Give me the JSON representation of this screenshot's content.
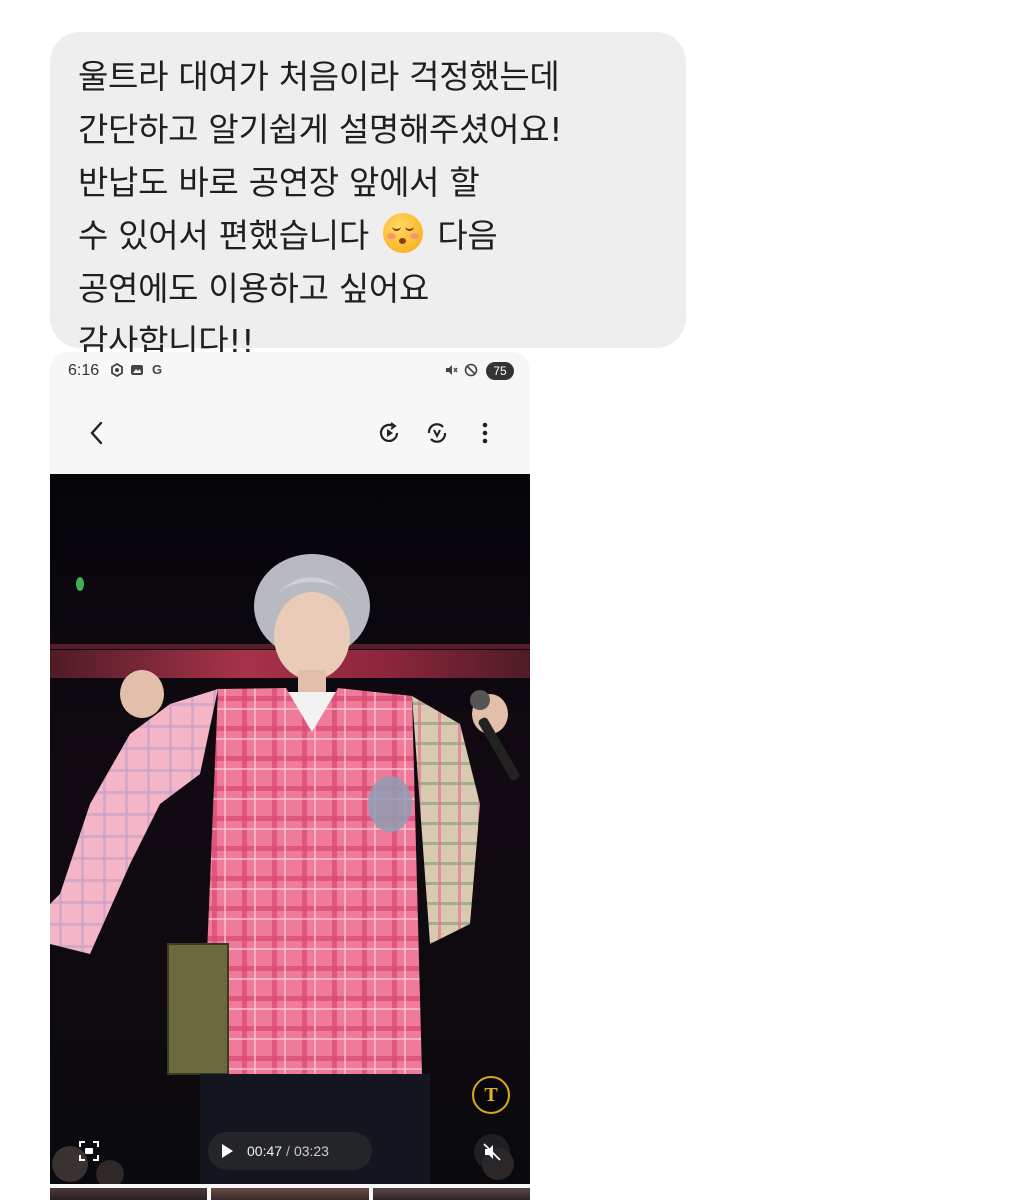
{
  "message": {
    "lines": [
      "울트라 대여가 처음이라 걱정했는데",
      "간단하고 알기쉽게 설명해주셨어요!",
      "반납도 바로 공연장 앞에서 할",
      "수 있어서 편했습니다",
      "다음",
      "공연에도 이용하고 싶어요",
      "감사합니다!!"
    ],
    "emoji": "kissing-face-with-closed-eyes",
    "bubble_color": "#eeeeef"
  },
  "screenshot": {
    "status_bar": {
      "time": "6:16",
      "left_icons": [
        "settings-app-icon",
        "gallery-app-icon",
        "google-icon"
      ],
      "google_letter": "G",
      "right_icons": [
        "mute-icon",
        "do-not-disturb-icon"
      ],
      "battery": "75"
    },
    "toolbar": {
      "icons": [
        "back-icon",
        "motion-play-icon",
        "remaster-icon",
        "more-options-icon"
      ]
    },
    "video": {
      "current_time": "00:47",
      "separator": "/",
      "total_time": "03:23",
      "text_extract_icon": "T",
      "icons": [
        "text-extract-icon",
        "capture-icon",
        "play-icon",
        "mute-icon"
      ]
    },
    "accent_color": "#d9a81c"
  }
}
